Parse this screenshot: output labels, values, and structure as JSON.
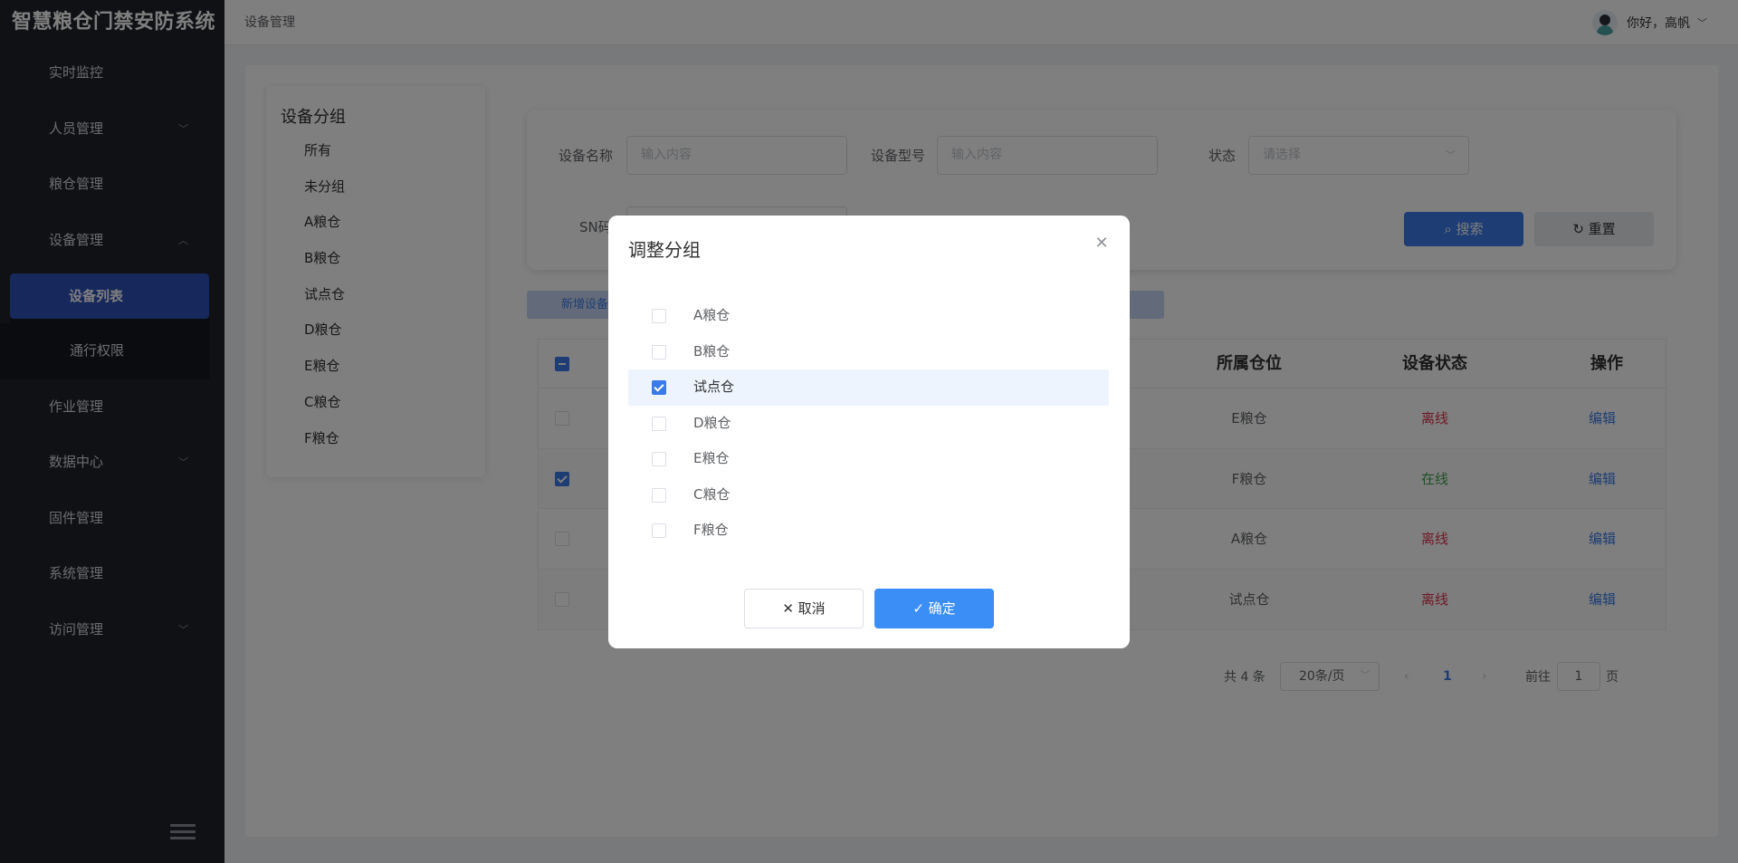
{
  "app": {
    "title": "智慧粮仓门禁安防系统"
  },
  "sidebar": {
    "items": [
      {
        "label": "实时监控"
      },
      {
        "label": "人员管理",
        "chevron": "down"
      },
      {
        "label": "粮仓管理"
      },
      {
        "label": "设备管理",
        "chevron": "up"
      },
      {
        "label": "作业管理"
      },
      {
        "label": "数据中心",
        "chevron": "down"
      },
      {
        "label": "固件管理"
      },
      {
        "label": "系统管理"
      },
      {
        "label": "访问管理",
        "chevron": "down"
      }
    ],
    "submenu": [
      {
        "label": "设备列表",
        "active": true
      },
      {
        "label": "通行权限"
      }
    ]
  },
  "header": {
    "breadcrumb": "设备管理",
    "greeting": "你好，高帆"
  },
  "groups": {
    "title": "设备分组",
    "items": [
      "所有",
      "未分组",
      "A粮仓",
      "B粮仓",
      "试点仓",
      "D粮仓",
      "E粮仓",
      "C粮仓",
      "F粮仓"
    ]
  },
  "search": {
    "name_label": "设备名称",
    "name_placeholder": "输入内容",
    "model_label": "设备型号",
    "model_placeholder": "输入内容",
    "status_label": "状态",
    "status_placeholder": "请选择",
    "sn_label": "SN码",
    "search_btn": "搜索",
    "reset_btn": "重置"
  },
  "toolbar": {
    "new_device": "新增设备"
  },
  "table": {
    "headers": {
      "location": "所属仓位",
      "status": "设备状态",
      "action": "操作"
    },
    "rows": [
      {
        "location": "E粮仓",
        "status": "离线",
        "online": false,
        "action": "编辑",
        "checked": false
      },
      {
        "location": "F粮仓",
        "status": "在线",
        "online": true,
        "action": "编辑",
        "checked": true
      },
      {
        "location": "A粮仓",
        "status": "离线",
        "online": false,
        "action": "编辑",
        "checked": false
      },
      {
        "location": "试点仓",
        "status": "离线",
        "online": false,
        "action": "编辑",
        "checked": false
      }
    ]
  },
  "pagination": {
    "total": "共 4 条",
    "page_size": "20条/页",
    "current": "1",
    "goto_label": "前往",
    "goto_value": "1",
    "page_unit": "页"
  },
  "dialog": {
    "title": "调整分组",
    "options": [
      {
        "label": "A粮仓",
        "checked": false
      },
      {
        "label": "B粮仓",
        "checked": false
      },
      {
        "label": "试点仓",
        "checked": true
      },
      {
        "label": "D粮仓",
        "checked": false
      },
      {
        "label": "E粮仓",
        "checked": false
      },
      {
        "label": "C粮仓",
        "checked": false
      },
      {
        "label": "F粮仓",
        "checked": false
      }
    ],
    "cancel": "取消",
    "confirm": "确定"
  },
  "colors": {
    "sidebar_bg": "#20232a",
    "active_menu": "#2d50b8",
    "primary": "#3a7be8",
    "offline": "#e0314a",
    "online": "#3fa34d"
  }
}
